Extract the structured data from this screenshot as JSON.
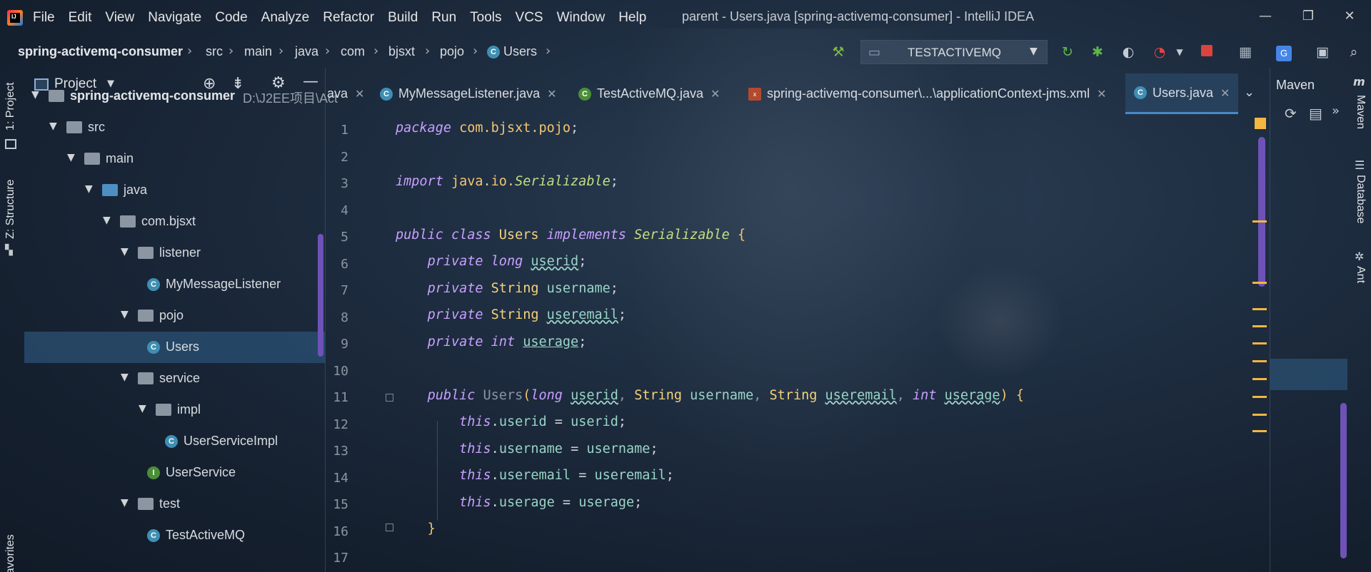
{
  "window": {
    "title": "parent - Users.java [spring-activemq-consumer] - IntelliJ IDEA",
    "controls": {
      "minimize": "—",
      "maximize": "❐",
      "close": "✕"
    }
  },
  "menu": [
    "File",
    "Edit",
    "View",
    "Navigate",
    "Code",
    "Analyze",
    "Refactor",
    "Build",
    "Run",
    "Tools",
    "VCS",
    "Window",
    "Help"
  ],
  "breadcrumb": [
    "spring-activemq-consumer",
    "src",
    "main",
    "java",
    "com",
    "bjsxt",
    "pojo",
    "Users"
  ],
  "run_config": {
    "label": "TESTACTIVEMQ"
  },
  "left_strip": {
    "project": "1: Project",
    "structure": "Z: Structure",
    "favorites": "Favorites"
  },
  "project_panel": {
    "title": "Project",
    "tree": [
      {
        "label": "spring-activemq-consumer",
        "path": "D:\\J2EE项目\\Act",
        "type": "module",
        "depth": 0
      },
      {
        "label": "src",
        "type": "folder",
        "depth": 1
      },
      {
        "label": "main",
        "type": "folder",
        "depth": 2
      },
      {
        "label": "java",
        "type": "source",
        "depth": 3
      },
      {
        "label": "com.bjsxt",
        "type": "package",
        "depth": 4
      },
      {
        "label": "listener",
        "type": "package",
        "depth": 5
      },
      {
        "label": "MyMessageListener",
        "type": "class",
        "depth": 6
      },
      {
        "label": "pojo",
        "type": "package",
        "depth": 5
      },
      {
        "label": "Users",
        "type": "class",
        "depth": 6,
        "selected": true
      },
      {
        "label": "service",
        "type": "package",
        "depth": 5
      },
      {
        "label": "impl",
        "type": "package",
        "depth": 6
      },
      {
        "label": "UserServiceImpl",
        "type": "class",
        "depth": 7
      },
      {
        "label": "UserService",
        "type": "interface",
        "depth": 6
      },
      {
        "label": "test",
        "type": "package",
        "depth": 5
      },
      {
        "label": "TestActiveMQ",
        "type": "test-class",
        "depth": 6
      }
    ]
  },
  "tabs": [
    {
      "label": "ava",
      "icon": "",
      "active": false
    },
    {
      "label": "MyMessageListener.java",
      "icon": "C",
      "active": false
    },
    {
      "label": "TestActiveMQ.java",
      "icon": "C",
      "active": false
    },
    {
      "label": "spring-activemq-consumer\\...\\applicationContext-jms.xml",
      "icon": "xml",
      "active": false
    },
    {
      "label": "Users.java",
      "icon": "C",
      "active": true
    }
  ],
  "editor": {
    "line_numbers": [
      "1",
      "2",
      "3",
      "4",
      "5",
      "6",
      "7",
      "8",
      "9",
      "10",
      "11",
      "12",
      "13",
      "14",
      "15",
      "16",
      "17"
    ]
  },
  "maven": {
    "title": "Maven"
  },
  "right_strip": {
    "maven": "Maven",
    "database": "Database",
    "ant": "Ant"
  },
  "colors": {
    "accent": "#4a88c7",
    "scrollbar": "#6e52b8",
    "warning": "#f5b642"
  }
}
